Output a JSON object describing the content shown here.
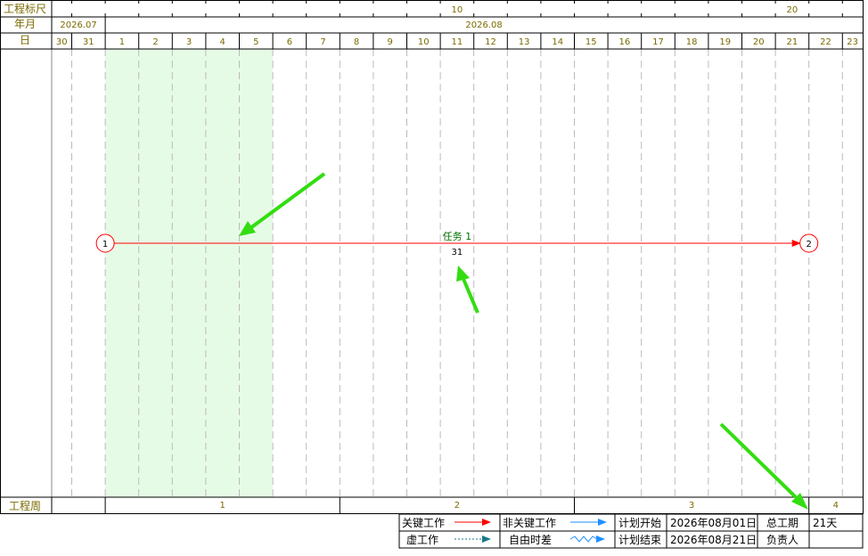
{
  "header": {
    "scale_label": "工程标尺",
    "month_label": "年月",
    "day_label": "日",
    "week_label": "工程周",
    "scale_ticks": [
      "10",
      "20"
    ],
    "months": [
      "2026.07",
      "2026.08"
    ],
    "days": [
      "30",
      "31",
      "1",
      "2",
      "3",
      "4",
      "5",
      "6",
      "7",
      "8",
      "9",
      "10",
      "11",
      "12",
      "13",
      "14",
      "15",
      "16",
      "17",
      "18",
      "19",
      "20",
      "21",
      "22",
      "23"
    ],
    "weeks": [
      "1",
      "2",
      "3",
      "4"
    ]
  },
  "highlight_days": [
    "1",
    "2",
    "3",
    "4",
    "5"
  ],
  "task": {
    "name": "任务 1",
    "duration": "31",
    "start_node": "1",
    "end_node": "2"
  },
  "legend": {
    "critical": "关键工作",
    "noncritical": "非关键工作",
    "dummy": "虚工作",
    "free_float": "自由时差",
    "plan_start_label": "计划开始",
    "plan_start_value": "2026年08月01日",
    "plan_end_label": "计划结束",
    "plan_end_value": "2026年08月21日",
    "total_duration_label": "总工期",
    "total_duration_value": "21天",
    "owner_label": "负责人",
    "owner_value": ""
  },
  "colors": {
    "header_text": "#7a6a00",
    "critical": "#ff0000",
    "noncritical": "#1e90ff",
    "dummy": "#1a7a8a",
    "highlight": "#e6fbe6",
    "task_label": "#007000",
    "grid": "#bbbbbb",
    "annotation_arrow": "#33dd11"
  }
}
